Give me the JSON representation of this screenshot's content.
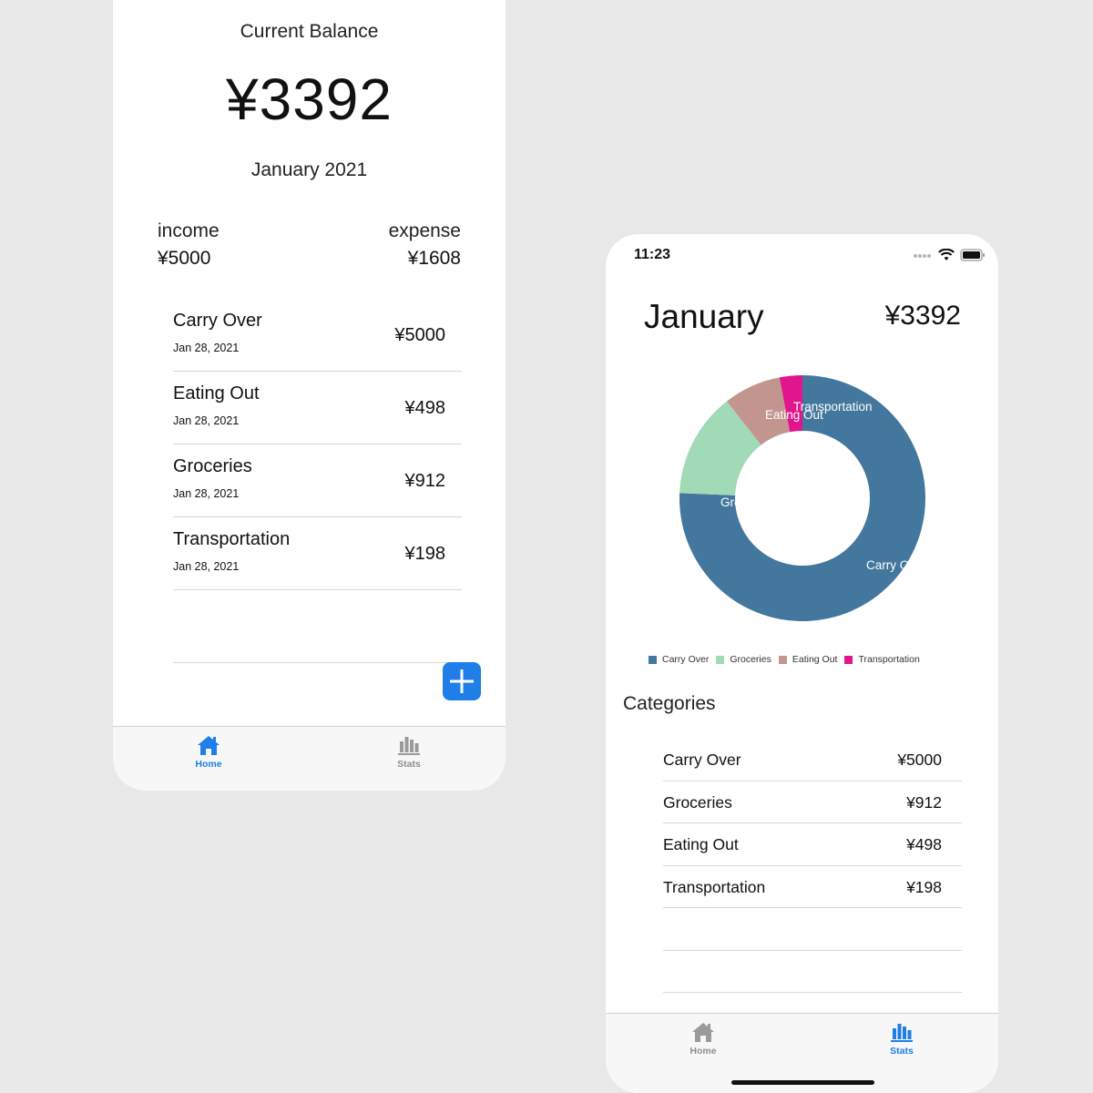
{
  "home": {
    "balance_label": "Current Balance",
    "balance_value": "¥3392",
    "month": "January 2021",
    "income_label": "income",
    "income_value": "¥5000",
    "expense_label": "expense",
    "expense_value": "¥1608",
    "transactions": [
      {
        "name": "Carry Over",
        "date": "Jan 28, 2021",
        "amount": "¥5000"
      },
      {
        "name": "Eating Out",
        "date": "Jan 28, 2021",
        "amount": "¥498"
      },
      {
        "name": "Groceries",
        "date": "Jan 28, 2021",
        "amount": "¥912"
      },
      {
        "name": "Transportation",
        "date": "Jan 28, 2021",
        "amount": "¥198"
      }
    ],
    "tabs": [
      {
        "label": "Home",
        "icon": "home-icon",
        "active": true
      },
      {
        "label": "Stats",
        "icon": "bar-chart-icon",
        "active": false
      }
    ]
  },
  "stats": {
    "status_time": "11:23",
    "title": "January",
    "total": "¥3392",
    "categories_title": "Categories",
    "categories": [
      {
        "name": "Carry Over",
        "amount": "¥5000"
      },
      {
        "name": "Groceries",
        "amount": "¥912"
      },
      {
        "name": "Eating Out",
        "amount": "¥498"
      },
      {
        "name": "Transportation",
        "amount": "¥198"
      }
    ],
    "tabs": [
      {
        "label": "Home",
        "icon": "home-icon",
        "active": false
      },
      {
        "label": "Stats",
        "icon": "bar-chart-icon",
        "active": true
      }
    ]
  },
  "colors": {
    "accent": "#1f7ee8",
    "carry_over": "#44779d",
    "groceries": "#a0dab6",
    "eating_out": "#c3958f",
    "transportation": "#e0168c"
  },
  "chart_data": {
    "type": "pie",
    "categories": [
      "Carry Over",
      "Groceries",
      "Eating Out",
      "Transportation"
    ],
    "values": [
      5000,
      912,
      498,
      198
    ],
    "legend_position": "bottom"
  }
}
